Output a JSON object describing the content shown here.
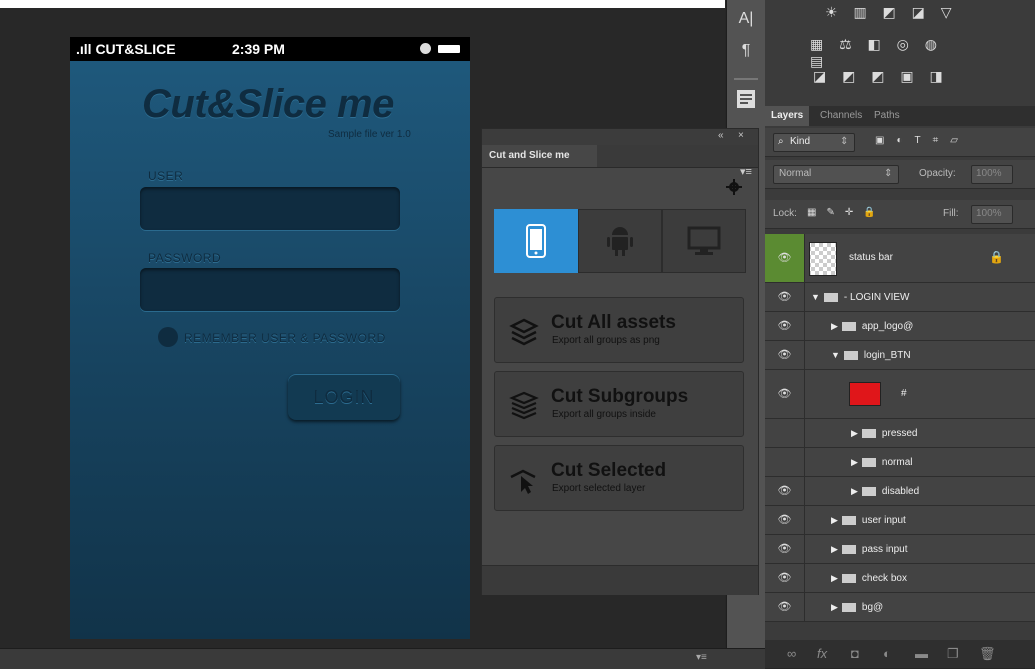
{
  "phone": {
    "carrier": ".ıll CUT&SLICE",
    "time": "2:39 PM",
    "logo": "Cut&Slice me",
    "subtitle": "Sample file ver 1.0",
    "user_label": "USER",
    "password_label": "PASSWORD",
    "remember_label": "REMEMBER USER & PASSWORD",
    "login_button": "LOGIN"
  },
  "toolstrip": {
    "items": [
      "A|",
      "¶"
    ]
  },
  "plugin": {
    "collapse": "«",
    "close": "×",
    "tab": "Cut and Slice me",
    "menu": "▾≡",
    "devices": [
      "ios",
      "android",
      "desktop"
    ],
    "selected_device": "ios",
    "actions": [
      {
        "title": "Cut All assets",
        "desc": "Export all groups as png"
      },
      {
        "title": "Cut Subgroups",
        "desc": "Export all groups inside"
      },
      {
        "title": "Cut Selected",
        "desc": "Export selected layer"
      }
    ]
  },
  "layers_panel": {
    "tabs": [
      "Layers",
      "Channels",
      "Paths"
    ],
    "filter_label": "Kind",
    "blend_mode": "Normal",
    "opacity_label": "Opacity:",
    "opacity_value": "100%",
    "lock_label": "Lock:",
    "fill_label": "Fill:",
    "fill_value": "100%",
    "layers": [
      {
        "name": "status bar",
        "type": "smart",
        "visible": true,
        "locked": true
      },
      {
        "name": "- LOGIN VIEW",
        "type": "group",
        "expanded": true,
        "indent": 0,
        "visible": true
      },
      {
        "name": "app_logo@",
        "type": "group",
        "expanded": false,
        "indent": 1,
        "visible": true
      },
      {
        "name": "login_BTN",
        "type": "group",
        "expanded": true,
        "indent": 1,
        "visible": true
      },
      {
        "name": "#",
        "type": "shape",
        "indent": 2,
        "visible": true
      },
      {
        "name": "pressed",
        "type": "group",
        "expanded": false,
        "indent": 2,
        "visible": false
      },
      {
        "name": "normal",
        "type": "group",
        "expanded": false,
        "indent": 2,
        "visible": false
      },
      {
        "name": "disabled",
        "type": "group",
        "expanded": false,
        "indent": 2,
        "visible": true
      },
      {
        "name": "user input",
        "type": "group",
        "expanded": false,
        "indent": 1,
        "visible": true
      },
      {
        "name": "pass input",
        "type": "group",
        "expanded": false,
        "indent": 1,
        "visible": true
      },
      {
        "name": "check box",
        "type": "group",
        "expanded": false,
        "indent": 1,
        "visible": true
      },
      {
        "name": "bg@",
        "type": "group",
        "expanded": false,
        "indent": 1,
        "visible": true
      }
    ]
  },
  "colors": {
    "accent": "#2d8fd4",
    "phone_bg": "#1f5a7e",
    "selected_layer": "#5b8b32",
    "swatch": "#e0161a"
  }
}
